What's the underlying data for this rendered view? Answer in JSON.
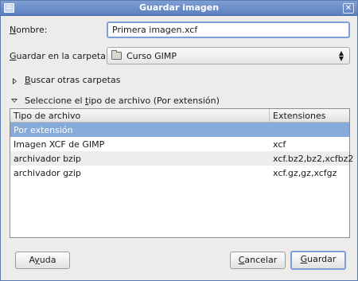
{
  "window": {
    "title": "Guardar imagen"
  },
  "name_field": {
    "label_pre": "",
    "label_key": "N",
    "label_post": "ombre:",
    "value": "Primera imagen.xcf"
  },
  "folder_field": {
    "label_pre": "",
    "label_key": "G",
    "label_post": "uardar en la carpeta:",
    "value": "Curso GIMP"
  },
  "browse_expander": {
    "label_pre": "",
    "label_key": "B",
    "label_post": "uscar otras carpetas"
  },
  "filetype_expander": {
    "label_pre": "Seleccione el ",
    "label_key": "t",
    "label_post": "ipo de archivo (Por extensión)"
  },
  "table": {
    "headers": [
      "Tipo de archivo",
      "Extensiones"
    ],
    "rows": [
      {
        "type": "Por extensión",
        "ext": ""
      },
      {
        "type": "Imagen XCF de GIMP",
        "ext": "xcf"
      },
      {
        "type": "archivador bzip",
        "ext": "xcf.bz2,bz2,xcfbz2"
      },
      {
        "type": "archivador gzip",
        "ext": "xcf.gz,gz,xcfgz"
      }
    ]
  },
  "buttons": {
    "help_pre": "A",
    "help_key": "y",
    "help_post": "uda",
    "cancel_pre": "",
    "cancel_key": "C",
    "cancel_post": "ancelar",
    "save_pre": "",
    "save_key": "G",
    "save_post": "uardar"
  },
  "colors": {
    "selection": "#86abd9",
    "titlebar": "#5c80c0",
    "focus": "#7b9fd8"
  }
}
